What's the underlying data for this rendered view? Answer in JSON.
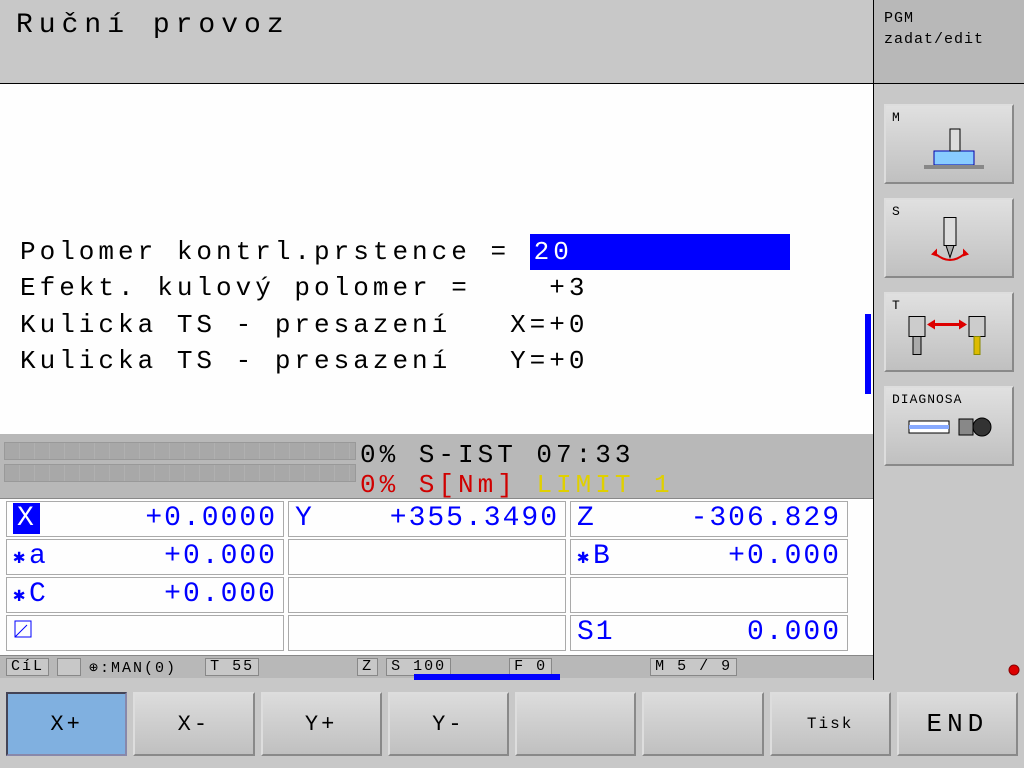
{
  "header": {
    "title": "Ruční provoz",
    "mode_line1": "PGM",
    "mode_line2": "zadat/edit"
  },
  "params": [
    {
      "label": "Polomer kontrl.prstence = ",
      "value": "20",
      "highlight": true
    },
    {
      "label": "Efekt. kulový polomer =    ",
      "value": "+3",
      "highlight": false
    },
    {
      "label": "Kulicka TS - presazení   X=",
      "value": "+0",
      "highlight": false
    },
    {
      "label": "Kulicka TS - presazení   Y=",
      "value": "+0",
      "highlight": false
    }
  ],
  "status": {
    "line1": "0% S-IST 07:33",
    "line2_red": "0% S[Nm] ",
    "line2_yellow": "LIMIT 1"
  },
  "coords": {
    "rows": [
      [
        {
          "prefix": "",
          "axis": "X",
          "value": "+0.0000",
          "axis_highlight": true
        },
        {
          "prefix": "",
          "axis": "Y",
          "value": "+355.3490"
        },
        {
          "prefix": "",
          "axis": "Z",
          "value": "-306.829"
        }
      ],
      [
        {
          "prefix": "✱",
          "axis": "a",
          "value": "+0.000"
        },
        {
          "empty": true
        },
        {
          "prefix": "✱",
          "axis": "B",
          "value": "+0.000"
        }
      ],
      [
        {
          "prefix": "✱",
          "axis": "C",
          "value": "+0.000"
        },
        {
          "empty": true
        },
        {
          "empty": true
        }
      ],
      [
        {
          "icon": true
        },
        {
          "empty": true
        },
        {
          "prefix": "",
          "axis": "S1",
          "value": "0.000"
        }
      ]
    ]
  },
  "bottom_status": {
    "cil": "CíL",
    "man": "⊕:MAN(0)",
    "t": "T 55",
    "z": "Z",
    "s": "S 100",
    "f": "F 0",
    "m": "M 5 / 9"
  },
  "sidebar": [
    {
      "label": "M",
      "icon": "machine"
    },
    {
      "label": "S",
      "icon": "spindle"
    },
    {
      "label": "T",
      "icon": "tool"
    },
    {
      "label": "DIAGNOSA",
      "icon": "diag"
    },
    {
      "label": "",
      "icon": ""
    },
    {
      "label": "",
      "icon": ""
    }
  ],
  "footer": [
    {
      "label": "X+",
      "active": true
    },
    {
      "label": "X-"
    },
    {
      "label": "Y+"
    },
    {
      "label": "Y-"
    },
    {
      "label": ""
    },
    {
      "label": ""
    },
    {
      "label": "Tisk",
      "cls": "tisk"
    },
    {
      "label": "END",
      "cls": "end"
    }
  ]
}
